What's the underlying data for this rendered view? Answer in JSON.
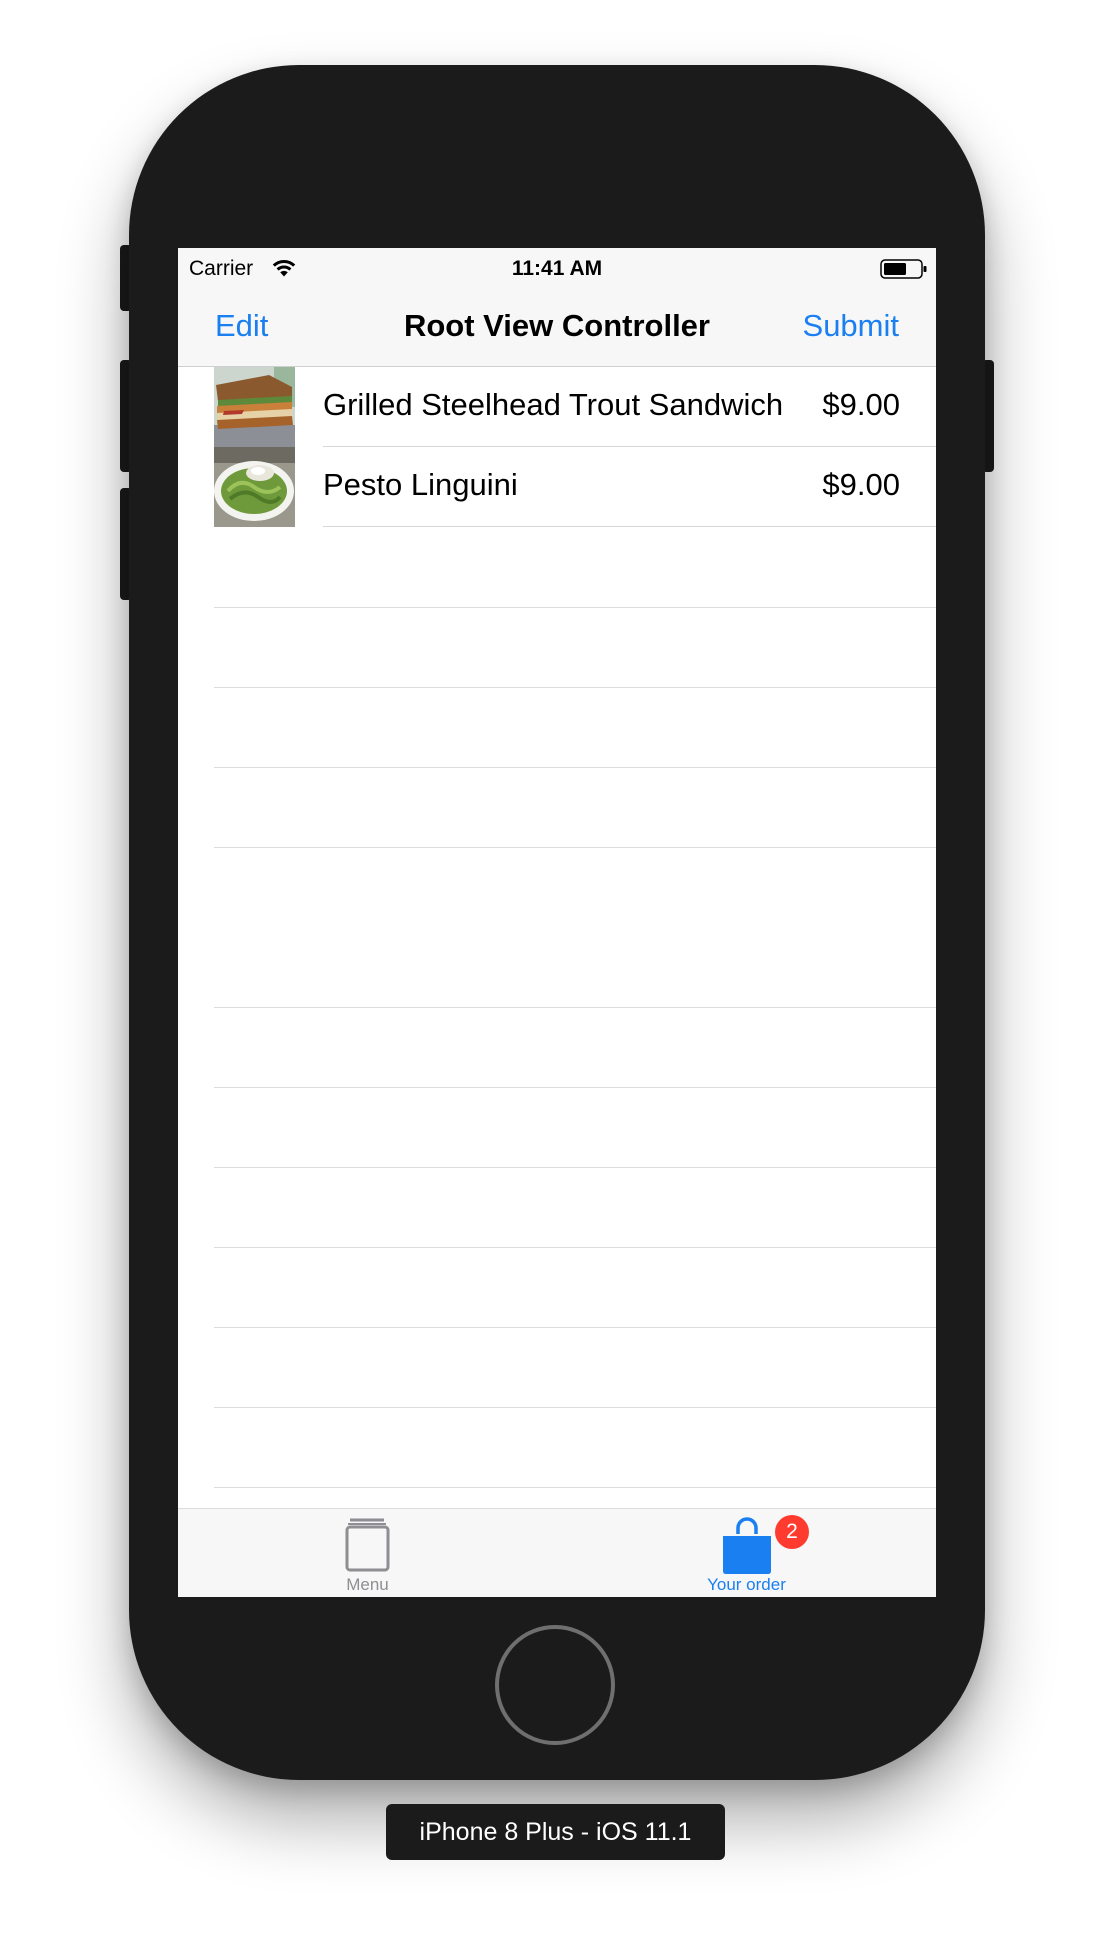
{
  "status_bar": {
    "carrier": "Carrier",
    "time": "11:41 AM",
    "wifi_icon": "wifi-icon",
    "battery_icon": "battery-icon"
  },
  "nav_bar": {
    "left_button": "Edit",
    "title": "Root View Controller",
    "right_button": "Submit",
    "accent_color": "#1a7ff1"
  },
  "order_items": [
    {
      "name": "Grilled Steelhead Trout Sandwich",
      "price": "$9.00",
      "image": "sandwich-photo"
    },
    {
      "name": "Pesto Linguini",
      "price": "$9.00",
      "image": "pasta-photo"
    }
  ],
  "tab_bar": {
    "tabs": [
      {
        "label": "Menu",
        "icon": "book-icon",
        "selected": false
      },
      {
        "label": "Your order",
        "icon": "shopping-bag-icon",
        "selected": true,
        "badge": "2"
      }
    ],
    "badge_color": "#ff3b30"
  },
  "device": {
    "caption": "iPhone 8 Plus - iOS 11.1"
  }
}
